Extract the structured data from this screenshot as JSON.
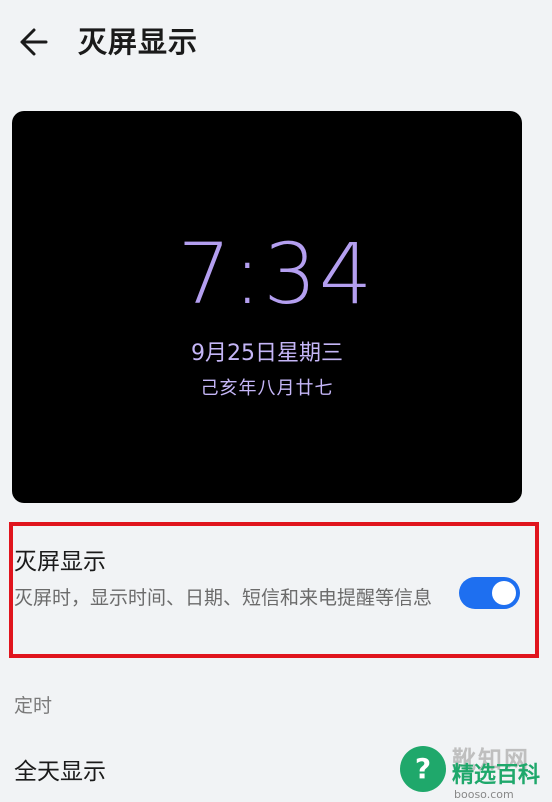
{
  "header": {
    "title": "灭屏显示",
    "back_icon": "arrow-left-icon"
  },
  "preview": {
    "time": "7:34",
    "date": "9月25日星期三",
    "lunar_date": "己亥年八月廿七",
    "text_color": "#b49ff0"
  },
  "aod_setting": {
    "title": "灭屏显示",
    "description": "灭屏时，显示时间、日期、短信和来电提醒等信息",
    "enabled": true,
    "toggle_color": "#1e6ff0",
    "highlight_color": "#e0141d"
  },
  "schedule": {
    "section_label": "定时",
    "all_day_label": "全天显示"
  },
  "watermark": {
    "top_text": "靴知网",
    "brand_text": "精选百科",
    "domain_text": "booso.com",
    "icon": "question-mark-icon",
    "icon_char": "?"
  }
}
